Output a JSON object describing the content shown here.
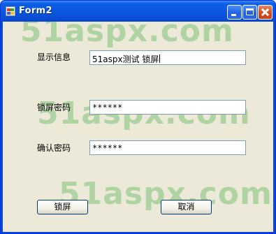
{
  "window": {
    "title": "Form2",
    "icon": "form-app-icon",
    "controls": [
      "minimize-icon",
      "maximize-icon",
      "close-icon"
    ]
  },
  "watermark": [
    "51aspx.com",
    "51aspx.com",
    "51aspx.com"
  ],
  "form": {
    "display_label": "显示信息",
    "display_value": "51aspx测试 锁屏",
    "lock_password_label": "锁屏密码",
    "lock_password_value": "******",
    "confirm_password_label": "确认密码",
    "confirm_password_value": "******"
  },
  "buttons": {
    "lock": "锁屏",
    "cancel": "取消"
  },
  "colors": {
    "titlebar": "#0a4fd6",
    "client": "#ece9d8",
    "watermark": "#5fb55f"
  }
}
